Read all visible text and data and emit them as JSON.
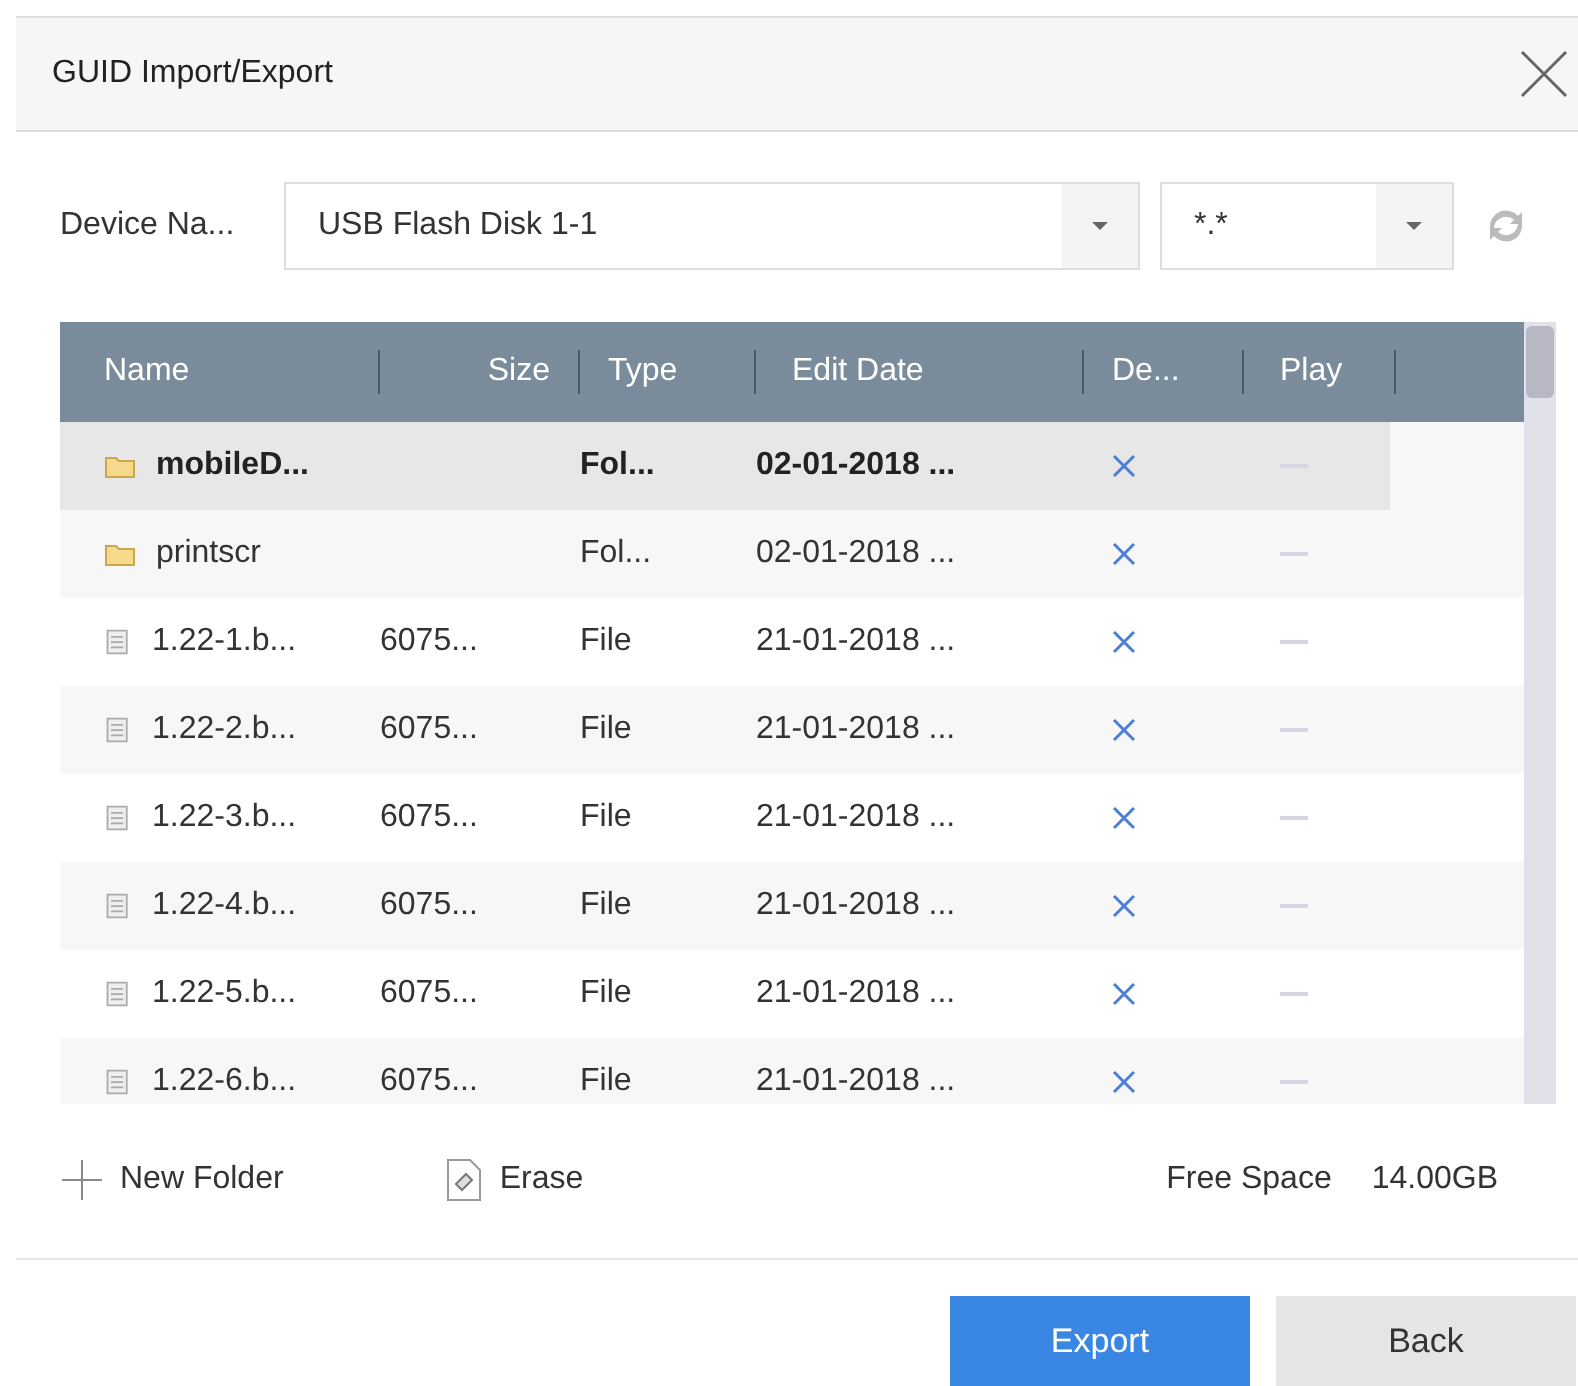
{
  "window": {
    "title": "GUID Import/Export"
  },
  "device": {
    "label": "Device Na...",
    "value": "USB Flash Disk 1-1",
    "filter": "*.*"
  },
  "table": {
    "columns": [
      "Name",
      "Size",
      "Type",
      "Edit Date",
      "De...",
      "Play"
    ],
    "rows": [
      {
        "kind": "folder",
        "selected": true,
        "name": "mobileD...",
        "size": "",
        "type": "Fol...",
        "date": "02-01-2018 ..."
      },
      {
        "kind": "folder",
        "selected": false,
        "name": "printscr",
        "size": "",
        "type": "Fol...",
        "date": "02-01-2018 ..."
      },
      {
        "kind": "file",
        "selected": false,
        "name": "1.22-1.b...",
        "size": "6075...",
        "type": "File",
        "date": "21-01-2018 ..."
      },
      {
        "kind": "file",
        "selected": false,
        "name": "1.22-2.b...",
        "size": "6075...",
        "type": "File",
        "date": "21-01-2018 ..."
      },
      {
        "kind": "file",
        "selected": false,
        "name": "1.22-3.b...",
        "size": "6075...",
        "type": "File",
        "date": "21-01-2018 ..."
      },
      {
        "kind": "file",
        "selected": false,
        "name": "1.22-4.b...",
        "size": "6075...",
        "type": "File",
        "date": "21-01-2018 ..."
      },
      {
        "kind": "file",
        "selected": false,
        "name": "1.22-5.b...",
        "size": "6075...",
        "type": "File",
        "date": "21-01-2018 ..."
      },
      {
        "kind": "file",
        "selected": false,
        "name": "1.22-6.b...",
        "size": "6075...",
        "type": "File",
        "date": "21-01-2018 ..."
      }
    ]
  },
  "tools": {
    "new_folder": "New Folder",
    "erase": "Erase",
    "free_space_label": "Free Space",
    "free_space": "14.00GB"
  },
  "buttons": [
    {
      "label": "Export",
      "kind": "primary"
    },
    {
      "label": "Back",
      "kind": "secondary"
    }
  ]
}
